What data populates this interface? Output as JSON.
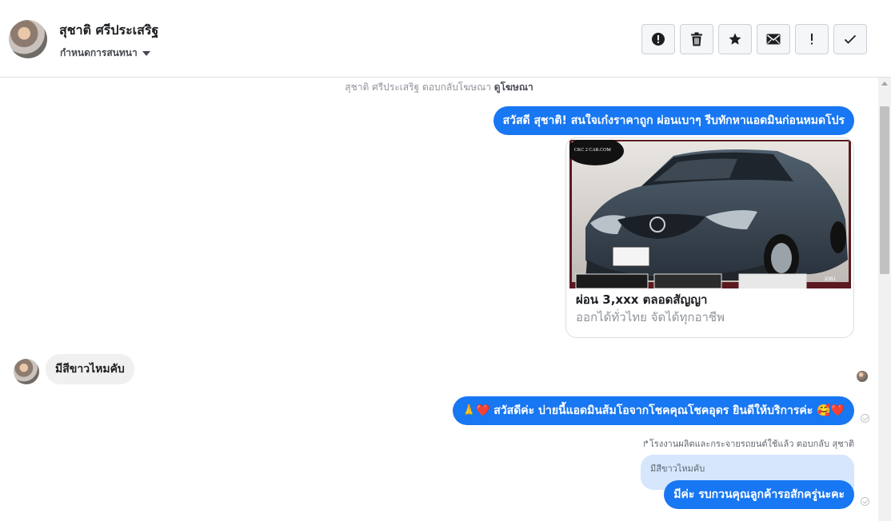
{
  "header": {
    "name": "สุชาติ ศรีประเสริฐ",
    "label_menu": "กำหนดการสนทนา",
    "actions": [
      {
        "name": "spam",
        "glyph": "!"
      },
      {
        "name": "delete"
      },
      {
        "name": "star"
      },
      {
        "name": "unread"
      },
      {
        "name": "follow-up",
        "glyph": "!"
      },
      {
        "name": "done"
      }
    ]
  },
  "conversation": {
    "reply_note_text": "สุชาติ ศรีประเสริฐ ตอบกลับโฆษณา",
    "reply_note_link": "ดูโฆษณา",
    "msg1": "สวัสดี สุชาติ! สนใจเก๋งราคาถูก ผ่อนเบาๆ รีบทักหาแอดมินก่อนหมดโปร",
    "ad": {
      "logo_text": "CKC 2 CAR.COM",
      "title": "ผ่อน 3,xxx ตลอดสัญญา",
      "subtitle": "ออกได้ทั่วไทย จัดได้ทุกอาชีพ"
    },
    "msg2": "มีสีขาวไหมคับ",
    "msg3": "🙏❤️ สวัสดีค่ะ บ่ายนี้แอดมินส้มโอจากโชคคุณโชคอุดร ยินดีให้บริการค่ะ 🥰❤️",
    "reply_label": "โรงงานผลิตและกระจายรถยนต์ใช้แล้ว ตอบกลับ สุชาติ",
    "quoted": "มีสีขาวไหมคับ",
    "msg4": "มีค่ะ รบกวนคุณลูกค้ารอสักครู่นะคะ"
  },
  "colors": {
    "accent": "#1877f2",
    "incoming": "#f0f0f0",
    "quote_bg": "#d6e6fd"
  }
}
